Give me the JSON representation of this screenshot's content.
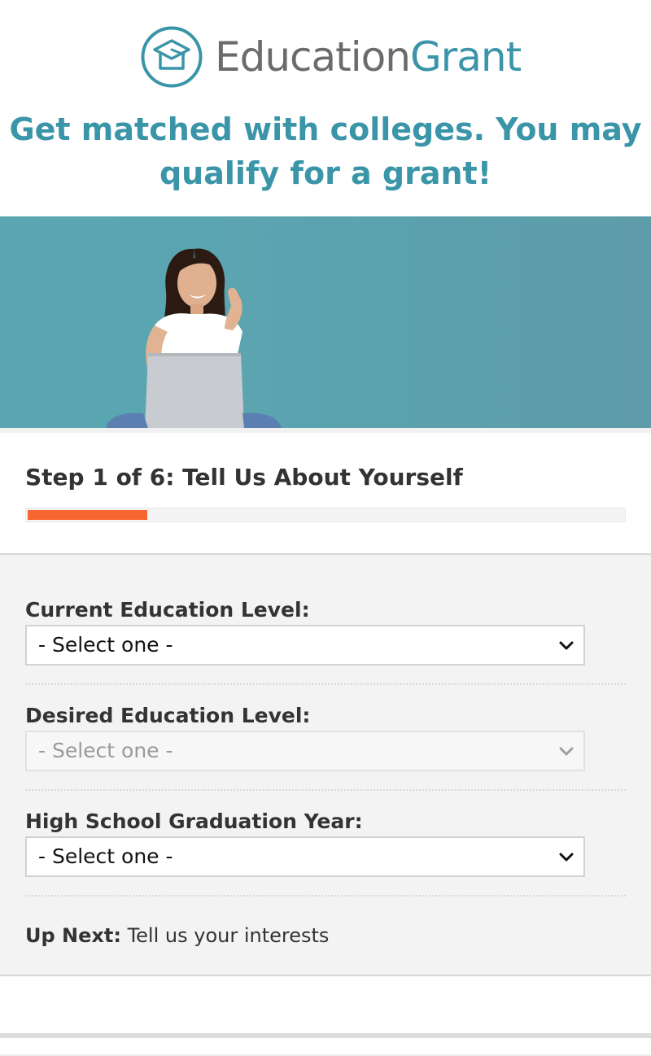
{
  "brand": {
    "name_part1": "Education",
    "name_part2": "Grant",
    "primary_color": "#3a95a8",
    "gray_color": "#6b6b6b"
  },
  "headline": "Get matched with colleges. You may qualify for a grant!",
  "step": {
    "title": "Step 1 of 6: Tell Us About Yourself",
    "current": 1,
    "total": 6,
    "progress_fraction": 0.2,
    "progress_color": "#f76631"
  },
  "fields": [
    {
      "label": "Current Education Level:",
      "value": "- Select one -",
      "disabled": false
    },
    {
      "label": "Desired Education Level:",
      "value": "- Select one -",
      "disabled": true
    },
    {
      "label": "High School Graduation Year:",
      "value": "- Select one -",
      "disabled": false
    }
  ],
  "up_next": {
    "prefix": "Up Next:",
    "text": "Tell us your interests"
  },
  "icons": [
    "graduation-cap-logo-icon",
    "chevron-down-icon"
  ]
}
